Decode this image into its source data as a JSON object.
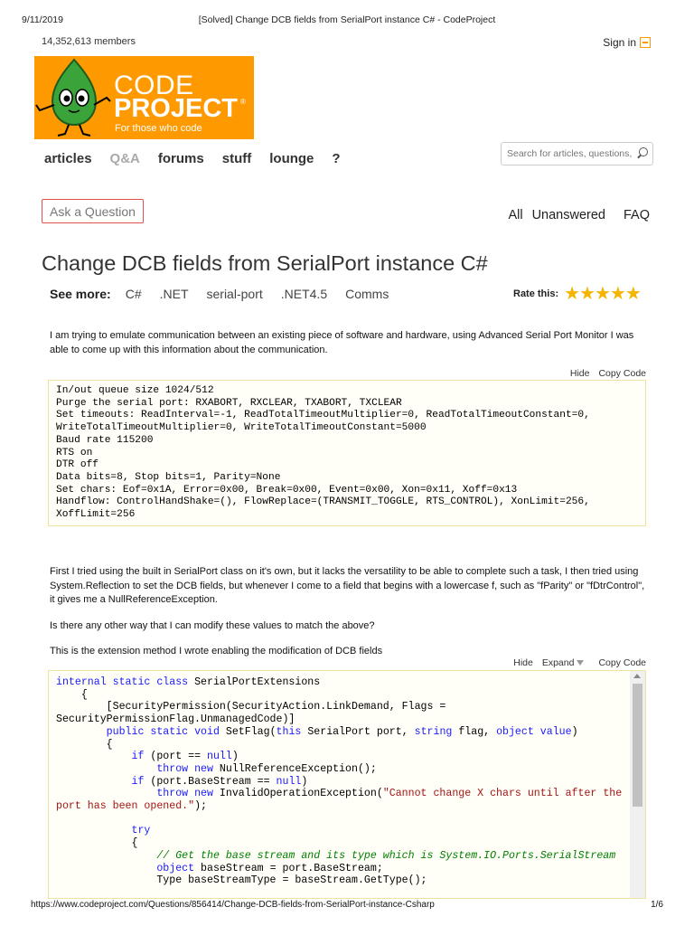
{
  "print_header": {
    "date": "9/11/2019",
    "title": "[Solved] Change DCB fields from SerialPort instance C# - CodeProject"
  },
  "header": {
    "members": "14,352,613 members",
    "sign_in": "Sign in"
  },
  "logo": {
    "line1": "CODE",
    "line2": "PROJECT",
    "registered": "®",
    "tagline": "For those who code",
    "color": "#ff9900"
  },
  "nav": {
    "items": [
      "articles",
      "Q&A",
      "forums",
      "stuff",
      "lounge",
      "?"
    ]
  },
  "search": {
    "placeholder": "Search for articles, questions, tips"
  },
  "qa": {
    "ask_label": "Ask a Question",
    "links": [
      "All",
      "Unanswered",
      "FAQ"
    ]
  },
  "question": {
    "title": "Change DCB fields from SerialPort instance C#",
    "see_more_label": "See more:",
    "tags": [
      "C#",
      ".NET",
      "serial-port",
      ".NET4.5",
      "Comms"
    ],
    "rate_label": "Rate this:",
    "stars": "★★★★★",
    "p1": "I am trying to emulate communication between an existing piece of software and hardware, using Advanced Serial Port Monitor I was able to come up with this information about the communication.",
    "p2": "First I tried using the built in SerialPort class on it's own, but it lacks the versatility to be able to complete such a task, I then tried using System.Reflection to set the DCB fields, but whenever I come to a field that begins with a lowercase f, such as \"fParity\" or \"fDtrControl\", it gives me a NullReferenceException.",
    "p3": "Is there any other way that I can modify these values to match the above?",
    "p4": "This is the extension method I wrote enabling the modification of DCB fields"
  },
  "code_block_1": {
    "hide": "Hide",
    "copy": "Copy Code",
    "lines": [
      "In/out queue size 1024/512",
      "Purge the serial port: RXABORT, RXCLEAR, TXABORT, TXCLEAR",
      "Set timeouts: ReadInterval=-1, ReadTotalTimeoutMultiplier=0, ReadTotalTimeoutConstant=0,",
      "WriteTotalTimeoutMultiplier=0, WriteTotalTimeoutConstant=5000",
      "Baud rate 115200",
      "RTS on",
      "DTR off",
      "Data bits=8, Stop bits=1, Parity=None",
      "Set chars: Eof=0x1A, Error=0x00, Break=0x00, Event=0x00, Xon=0x11, Xoff=0x13",
      "Handflow: ControlHandShake=(), FlowReplace=(TRANSMIT_TOGGLE, RTS_CONTROL), XonLimit=256,",
      "XoffLimit=256"
    ]
  },
  "code_block_2": {
    "hide": "Hide",
    "expand": "Expand",
    "copy": "Copy Code",
    "lines": [
      [
        {
          "t": "internal static class",
          "c": "kw"
        },
        {
          "t": " SerialPortExtensions"
        }
      ],
      [
        {
          "t": "    {"
        }
      ],
      [
        {
          "t": "        [SecurityPermission(SecurityAction.LinkDemand, Flags ="
        }
      ],
      [
        {
          "t": "SecurityPermissionFlag.UnmanagedCode)]"
        }
      ],
      [
        {
          "t": "        "
        },
        {
          "t": "public static void",
          "c": "kw"
        },
        {
          "t": " SetFlag("
        },
        {
          "t": "this",
          "c": "kw"
        },
        {
          "t": " SerialPort port, "
        },
        {
          "t": "string",
          "c": "kw"
        },
        {
          "t": " flag, "
        },
        {
          "t": "object",
          "c": "kw"
        },
        {
          "t": " "
        },
        {
          "t": "value",
          "c": "kw"
        },
        {
          "t": ")"
        }
      ],
      [
        {
          "t": "        {"
        }
      ],
      [
        {
          "t": "            "
        },
        {
          "t": "if",
          "c": "kw"
        },
        {
          "t": " (port == "
        },
        {
          "t": "null",
          "c": "kw"
        },
        {
          "t": ")"
        }
      ],
      [
        {
          "t": "                "
        },
        {
          "t": "throw new",
          "c": "kw"
        },
        {
          "t": " NullReferenceException();"
        }
      ],
      [
        {
          "t": "            "
        },
        {
          "t": "if",
          "c": "kw"
        },
        {
          "t": " (port.BaseStream == "
        },
        {
          "t": "null",
          "c": "kw"
        },
        {
          "t": ")"
        }
      ],
      [
        {
          "t": "                "
        },
        {
          "t": "throw new",
          "c": "kw"
        },
        {
          "t": " InvalidOperationException("
        },
        {
          "t": "\"Cannot change X chars until after the",
          "c": "str"
        }
      ],
      [
        {
          "t": "port has been opened.\"",
          "c": "str"
        },
        {
          "t": ");"
        }
      ],
      [
        {
          "t": ""
        }
      ],
      [
        {
          "t": "            "
        },
        {
          "t": "try",
          "c": "kw"
        }
      ],
      [
        {
          "t": "            {"
        }
      ],
      [
        {
          "t": "                "
        },
        {
          "t": "// Get the base stream and its type which is System.IO.Ports.SerialStream",
          "c": "cmt"
        }
      ],
      [
        {
          "t": "                "
        },
        {
          "t": "object",
          "c": "kw"
        },
        {
          "t": " baseStream = port.BaseStream;"
        }
      ],
      [
        {
          "t": "                Type baseStreamType = baseStream.GetType();"
        }
      ]
    ]
  },
  "footer": {
    "url": "https://www.codeproject.com/Questions/856414/Change-DCB-fields-from-SerialPort-instance-Csharp",
    "page": "1/6"
  }
}
